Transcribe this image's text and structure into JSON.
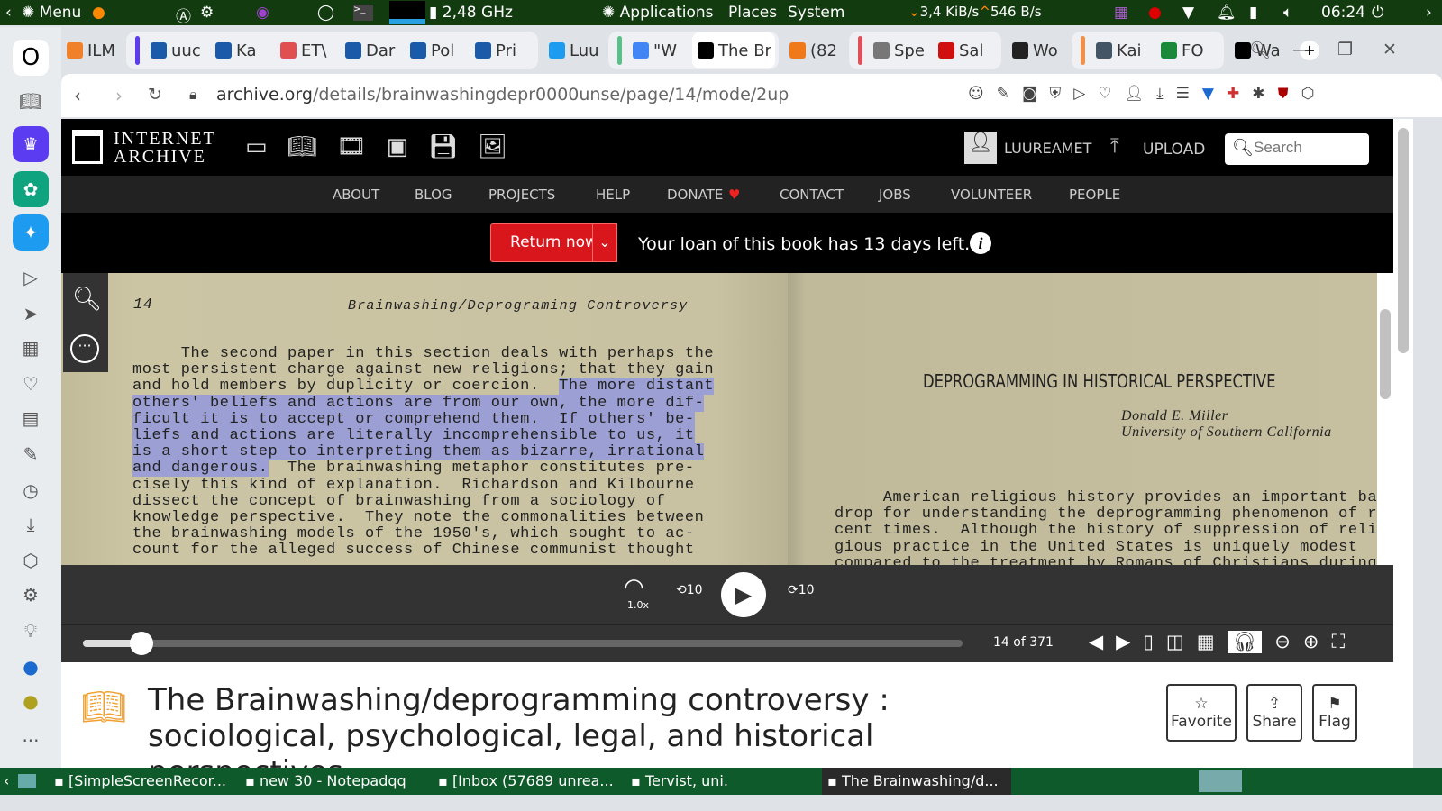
{
  "panel": {
    "menu": "Menu",
    "cpu": "2,48 GHz",
    "applications": "Applications",
    "places": "Places",
    "system": "System",
    "net": "3,4 KiB/s",
    "net_up": "546 B/s",
    "clock": "06:24"
  },
  "tabs": [
    {
      "label": "ILM",
      "icon": "ilm-icon",
      "color": "#f0802a"
    },
    {
      "label": "uuc",
      "icon": "err-icon",
      "color": "#1a5aa8"
    },
    {
      "label": "Ka",
      "icon": "err-icon",
      "color": "#1a5aa8"
    },
    {
      "label": "ET\\",
      "icon": "clock-app-icon",
      "color": "#e05050"
    },
    {
      "label": "Dar",
      "icon": "err-icon",
      "color": "#1a5aa8"
    },
    {
      "label": "Pol",
      "icon": "err-icon",
      "color": "#1a5aa8"
    },
    {
      "label": "Pri",
      "icon": "err-icon",
      "color": "#1a5aa8"
    },
    {
      "label": "Luu",
      "icon": "twitter-icon",
      "color": "#1d9bf0"
    },
    {
      "label": "\"W",
      "icon": "google-icon",
      "color": "#4285f4"
    },
    {
      "label": "The Br",
      "icon": "archive-icon",
      "color": "#000"
    },
    {
      "label": "(82",
      "icon": "fox-icon",
      "color": "#f07a1a"
    },
    {
      "label": "Spe",
      "icon": "grid-icon",
      "color": "#777"
    },
    {
      "label": "Sal",
      "icon": "ee-icon",
      "color": "#d01010"
    },
    {
      "label": "Wo",
      "icon": "a-icon",
      "color": "#222"
    },
    {
      "label": "Kai",
      "icon": "p-icon",
      "color": "#456"
    },
    {
      "label": "FO",
      "icon": "fo-icon",
      "color": "#1a8a3a"
    },
    {
      "label": "Wa",
      "icon": "archive-icon",
      "color": "#000"
    }
  ],
  "address": {
    "domain": "archive.org",
    "path": "/details/brainwashingdepr0000unse/page/14/mode/2up"
  },
  "ia": {
    "logo_line1": "INTERNET",
    "logo_line2": "ARCHIVE",
    "user": "LUUREAMET",
    "upload": "UPLOAD",
    "search_placeholder": "Search",
    "nav": [
      "ABOUT",
      "BLOG",
      "PROJECTS",
      "HELP",
      "DONATE",
      "CONTACT",
      "JOBS",
      "VOLUNTEER",
      "PEOPLE"
    ]
  },
  "loan": {
    "return_label": "Return now",
    "message": "Your loan of this book has 13 days left."
  },
  "book": {
    "left_page_number": "14",
    "left_header": "Brainwashing/Deprograming Controversy",
    "left_lines": [
      [
        {
          "t": "     The second paper in this section deals with perhaps the"
        }
      ],
      [
        {
          "t": "most persistent charge against new religions; that they gain"
        }
      ],
      [
        {
          "t": "and hold members by duplicity or coercion.  "
        },
        {
          "t": "The more distant",
          "h": true
        }
      ],
      [
        {
          "t": "others' beliefs and actions are from our own, the more dif-",
          "h": true
        }
      ],
      [
        {
          "t": "ficult it is to accept or comprehend them.  If others' be-",
          "h": true
        }
      ],
      [
        {
          "t": "liefs and actions are literally incomprehensible to us, it",
          "h": true
        }
      ],
      [
        {
          "t": "is a short step to interpreting them as bizarre, irrational",
          "h": true
        }
      ],
      [
        {
          "t": "and dangerous.",
          "h": true
        },
        {
          "t": "  The brainwashing metaphor constitutes pre-"
        }
      ],
      [
        {
          "t": "cisely this kind of explanation.  Richardson and Kilbourne"
        }
      ],
      [
        {
          "t": "dissect the concept of brainwashing from a sociology of"
        }
      ],
      [
        {
          "t": "knowledge perspective.  They note the commonalities between"
        }
      ],
      [
        {
          "t": "the brainwashing models of the 1950's, which sought to ac-"
        }
      ],
      [
        {
          "t": "count for the alleged success of Chinese communist thought"
        }
      ]
    ],
    "right_title": "DEPROGRAMMING IN HISTORICAL PERSPECTIVE",
    "right_author": "Donald E. Miller",
    "right_affiliation": "University of Southern California",
    "right_lines": [
      "     American religious history provides an important back-",
      "drop for understanding the deprogramming phenomenon of re-",
      "cent times.  Although the history of suppression of reli-",
      "gious practice in the United States is uniquely modest",
      "compared to the treatment by Romans of Christians during"
    ]
  },
  "player": {
    "speed": "1.0x",
    "skip_back": "10",
    "skip_fwd": "10",
    "progress_fraction": 0.067,
    "page_indicator": "14 of 371"
  },
  "details": {
    "title": "The Brainwashing/deprogramming controversy : sociological, psychological, legal, and historical perspectives",
    "favorite": "Favorite",
    "share": "Share",
    "flag": "Flag"
  },
  "taskbar": [
    "[SimpleScreenRecor...",
    "new 30 - Notepadqq",
    "[Inbox (57689 unrea...",
    "Tervist, uni.",
    "The Brainwashing/d..."
  ]
}
